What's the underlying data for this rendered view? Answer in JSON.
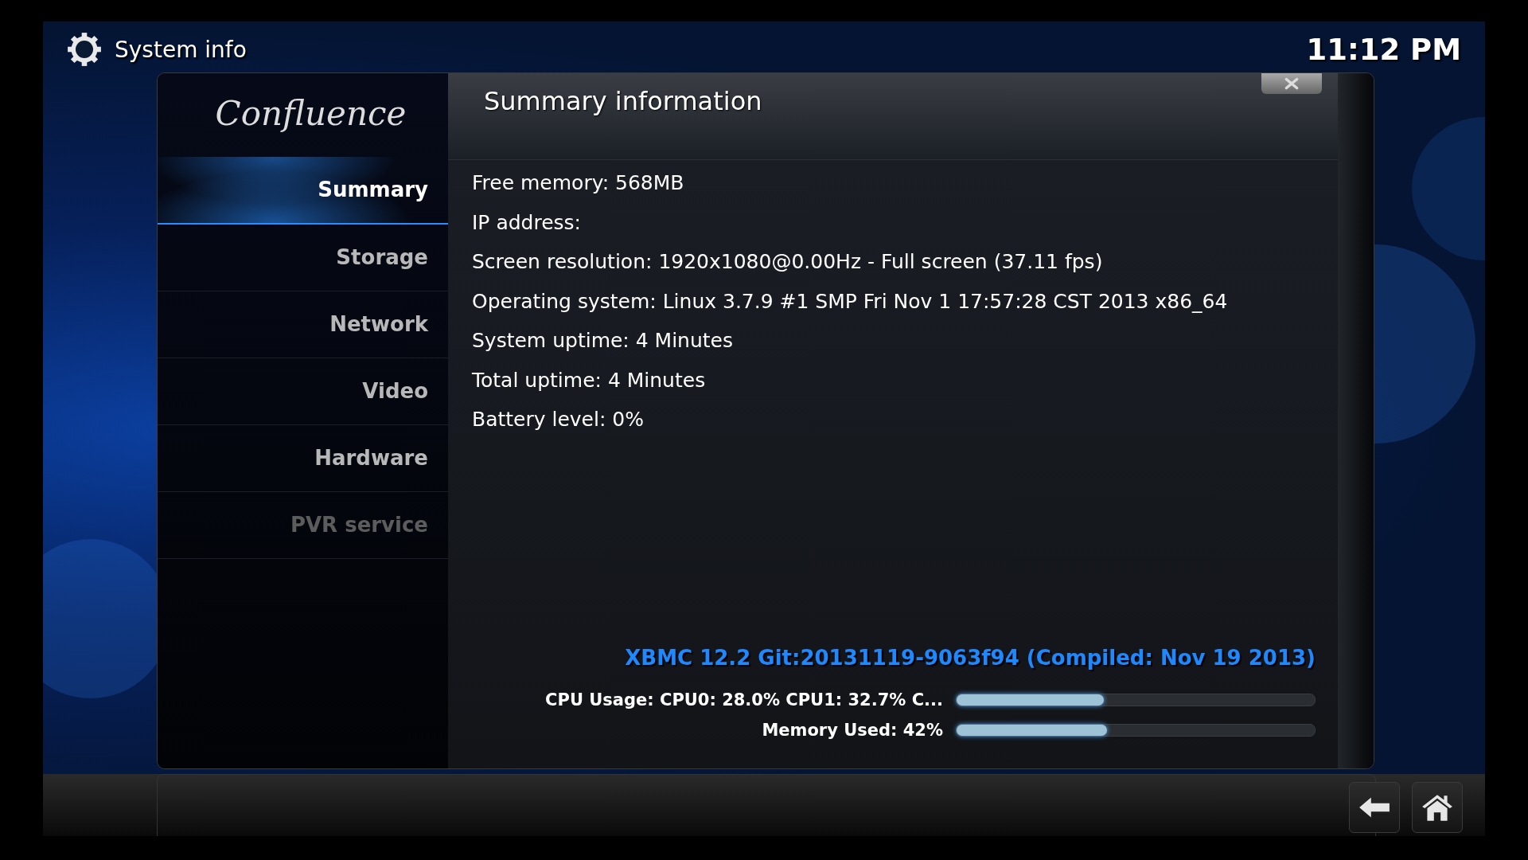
{
  "header": {
    "title": "System info",
    "clock": "11:12 PM"
  },
  "logo": "Confluence",
  "sidebar": {
    "items": [
      {
        "label": "Summary",
        "selected": true,
        "disabled": false
      },
      {
        "label": "Storage",
        "selected": false,
        "disabled": false
      },
      {
        "label": "Network",
        "selected": false,
        "disabled": false
      },
      {
        "label": "Video",
        "selected": false,
        "disabled": false
      },
      {
        "label": "Hardware",
        "selected": false,
        "disabled": false
      },
      {
        "label": "PVR service",
        "selected": false,
        "disabled": true
      }
    ]
  },
  "panel": {
    "title": "Summary information",
    "lines": [
      "Free memory: 568MB",
      "IP address:",
      "Screen resolution: 1920x1080@0.00Hz - Full screen (37.11 fps)",
      "Operating system: Linux 3.7.9 #1 SMP Fri Nov 1 17:57:28 CST 2013 x86_64",
      "System uptime: 4 Minutes",
      "Total uptime: 4 Minutes",
      "Battery level: 0%"
    ],
    "version": "XBMC 12.2 Git:20131119-9063f94 (Compiled: Nov 19 2013)",
    "meters": [
      {
        "label": "CPU Usage: CPU0: 28.0% CPU1: 32.7% C...",
        "level": 0.41
      },
      {
        "label": "Memory Used: 42%",
        "level": 0.42
      }
    ]
  }
}
